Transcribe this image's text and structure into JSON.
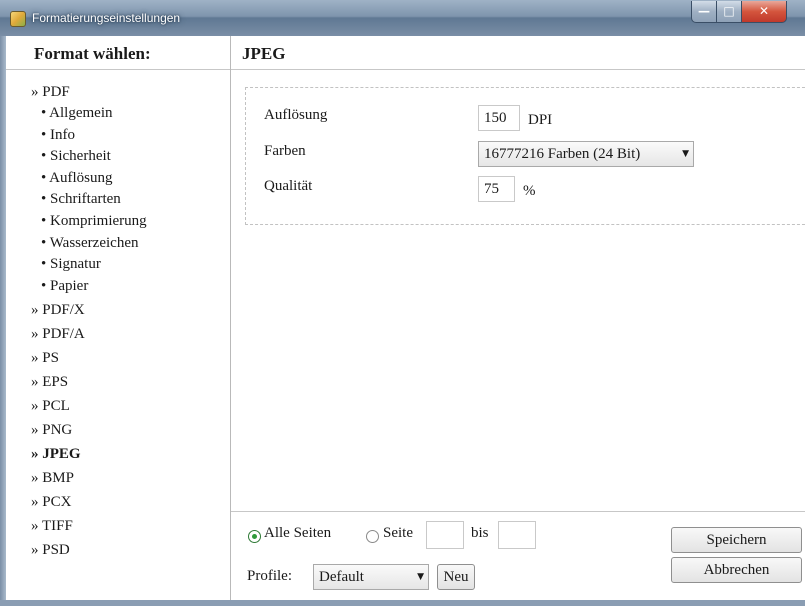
{
  "window": {
    "title": "Formatierungseinstellungen"
  },
  "sidebar": {
    "header": "Format wählen:",
    "formats": [
      {
        "label": "» PDF",
        "active": false,
        "subitems": [
          "• Allgemein",
          "• Info",
          "• Sicherheit",
          "• Auflösung",
          "• Schriftarten",
          "• Komprimierung",
          "• Wasserzeichen",
          "• Signatur",
          "• Papier"
        ]
      },
      {
        "label": "» PDF/X",
        "active": false
      },
      {
        "label": "» PDF/A",
        "active": false
      },
      {
        "label": "» PS",
        "active": false
      },
      {
        "label": "» EPS",
        "active": false
      },
      {
        "label": "» PCL",
        "active": false
      },
      {
        "label": "» PNG",
        "active": false
      },
      {
        "label": "» JPEG",
        "active": true
      },
      {
        "label": "» BMP",
        "active": false
      },
      {
        "label": "» PCX",
        "active": false
      },
      {
        "label": "» TIFF",
        "active": false
      },
      {
        "label": "» PSD",
        "active": false
      }
    ]
  },
  "main": {
    "title": "JPEG",
    "resolution": {
      "label": "Auflösung",
      "value": "150",
      "unit": "DPI"
    },
    "colors": {
      "label": "Farben",
      "value": "16777216 Farben (24 Bit)"
    },
    "quality": {
      "label": "Qualität",
      "value": "75",
      "unit": "%"
    }
  },
  "bottom": {
    "all_pages_label": "Alle Seiten",
    "page_label": "Seite",
    "to_label": "bis",
    "page_from": "",
    "page_to": "",
    "profile_label": "Profile:",
    "profile_value": "Default",
    "new_label": "Neu",
    "save_label": "Speichern",
    "cancel_label": "Abbrechen"
  }
}
